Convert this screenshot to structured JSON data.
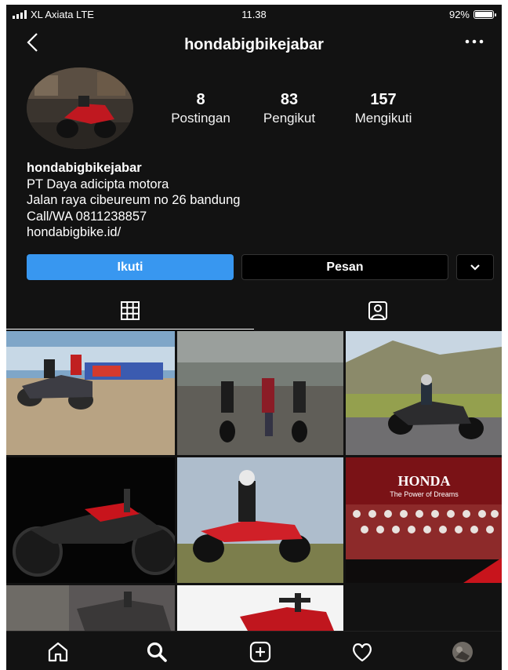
{
  "status_bar": {
    "carrier": "XL Axiata LTE",
    "time": "11.38",
    "battery": "92%",
    "battery_level": 0.92
  },
  "header": {
    "username": "hondabigbikejabar",
    "back_icon": "chevron-left-icon",
    "more_icon": "more-horizontal-icon"
  },
  "stats": [
    {
      "value": "8",
      "label": "Postingan"
    },
    {
      "value": "83",
      "label": "Pengikut"
    },
    {
      "value": "157",
      "label": "Mengikuti"
    }
  ],
  "bio": {
    "name": "hondabigbikejabar",
    "line1": "PT Daya adicipta motora",
    "line2": "Jalan raya cibeureum no 26 bandung",
    "line3": "Call/WA 0811238857",
    "link": "hondabigbike.id/"
  },
  "actions": {
    "follow": "Ikuti",
    "message": "Pesan",
    "dropdown_icon": "chevron-down-icon",
    "follow_color": "#3897f0"
  },
  "tabs": [
    {
      "icon": "grid-icon",
      "active": true
    },
    {
      "icon": "tagged-person-icon",
      "active": false
    }
  ],
  "posts": [
    {
      "description": "riders on sand beach with banners"
    },
    {
      "description": "group with motorcycles on road"
    },
    {
      "description": "rider on motorcycle in hills"
    },
    {
      "description": "red cruiser motorcycle on black background"
    },
    {
      "description": "rider on adventure motorcycle"
    },
    {
      "description": "group photo with honda banner",
      "banner_title": "HONDA",
      "banner_subtitle": "The Power of Dreams"
    },
    {
      "description": "grey motorcycle close-up"
    },
    {
      "description": "red touring motorcycle close-up"
    }
  ],
  "bottom_nav": [
    {
      "icon": "home-icon"
    },
    {
      "icon": "search-icon"
    },
    {
      "icon": "add-post-icon"
    },
    {
      "icon": "heart-icon"
    },
    {
      "icon": "profile-avatar-icon"
    }
  ]
}
